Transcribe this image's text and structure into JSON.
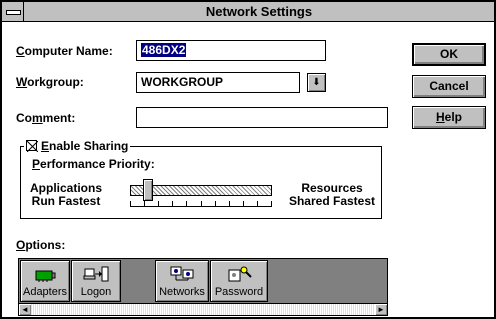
{
  "window": {
    "title": "Network Settings"
  },
  "computer_name": {
    "label_u": "C",
    "label_rest": "omputer Name:",
    "value": "486DX2"
  },
  "workgroup": {
    "label_u": "W",
    "label_rest": "orkgroup:",
    "value": "WORKGROUP",
    "dropdown_glyph": "⬇"
  },
  "comment": {
    "label_pre": "Co",
    "label_u": "m",
    "label_rest": "ment:",
    "value": ""
  },
  "buttons": {
    "ok": "OK",
    "cancel": "Cancel",
    "help_u": "H",
    "help_rest": "elp"
  },
  "sharing": {
    "enable_u": "E",
    "enable_rest": "nable Sharing",
    "enabled": true,
    "perf_u": "P",
    "perf_rest": "erformance Priority:",
    "left_line1": "Applications",
    "left_line2": "Run Fastest",
    "right_line1": "Resources",
    "right_line2": "Shared Fastest",
    "slider_level": 0.1
  },
  "options": {
    "label_u": "O",
    "label_rest": "ptions:",
    "items": [
      {
        "label": "Adapters",
        "icon": "network-adapter-icon"
      },
      {
        "label": "Logon",
        "icon": "logon-icon"
      },
      {
        "label": "Networks",
        "icon": "networks-icon"
      },
      {
        "label": "Password",
        "icon": "password-key-icon"
      }
    ]
  },
  "colors": {
    "desktop": "#d8c98a",
    "button_face": "#c0c0c0",
    "selection": "#000080",
    "options_bg": "#808080"
  }
}
